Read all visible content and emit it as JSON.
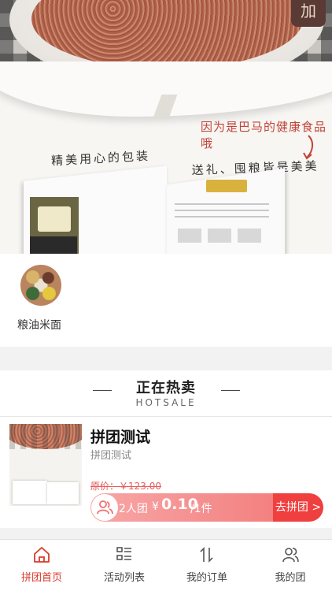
{
  "banner": {
    "corner_char": "加",
    "caption_red": "因为是巴马的健康食品哦",
    "caption_left": "精美用心的包装",
    "caption_right": "送礼、囤粮皆是美美的"
  },
  "categories": [
    {
      "label": "粮油米面",
      "icon": "grains-icon"
    }
  ],
  "hot_section": {
    "title": "正在热卖",
    "subtitle": "HOTSALE",
    "products": [
      {
        "name": "拼团测试",
        "description": "拼团测试",
        "original_price": "原价：￥123.00",
        "group_count": "2人团",
        "currency": "¥",
        "group_price": "0.10",
        "unit": "/1件",
        "join_label": "去拼团 >"
      }
    ]
  },
  "tabbar": {
    "items": [
      {
        "label": "拼团首页",
        "icon": "home-icon",
        "active": true
      },
      {
        "label": "活动列表",
        "icon": "list-icon",
        "active": false
      },
      {
        "label": "我的订单",
        "icon": "sort-icon",
        "active": false
      },
      {
        "label": "我的团",
        "icon": "group-icon",
        "active": false
      }
    ]
  },
  "colors": {
    "accent": "#d93a2a",
    "group_bar": "#f48a8a",
    "join_button": "#ef3f3f",
    "strike_price": "#e85a5a"
  }
}
